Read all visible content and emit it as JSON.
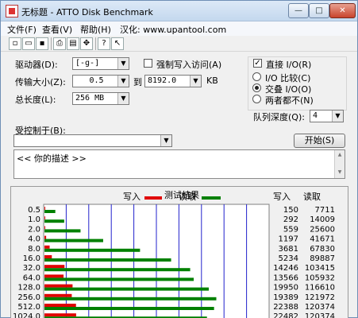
{
  "window": {
    "title": "无标题 - ATTO Disk Benchmark",
    "min": "—",
    "max": "□",
    "close": "✕"
  },
  "menu": [
    "文件(F)",
    "查看(V)",
    "帮助(H)",
    "汉化: www.upantool.com"
  ],
  "toolbar": [
    "new-icon",
    "open-icon",
    "save-icon",
    "print-icon",
    "preview-icon",
    "move-icon",
    "help-icon",
    "context-help-icon"
  ],
  "form": {
    "drive_label": "驱动器(D):",
    "drive_value": "[-g-]",
    "force_write_label": "强制写入访问(A)",
    "direct_io_label": "直接 I/O(R)",
    "transfer_label": "传输大小(Z):",
    "transfer_from": "0.5",
    "to_label": "到",
    "transfer_to": "8192.0",
    "kb_unit": "KB",
    "total_label": "总长度(L):",
    "total_value": "256 MB",
    "radio_compare": "I/O 比较(C)",
    "radio_overlap": "交叠 I/O(O)",
    "radio_neither": "两者都不(N)",
    "queue_label": "队列深度(Q):",
    "queue_value": "4",
    "controlled_label": "受控制于(B):",
    "controlled_value": "",
    "start_button": "开始(S)",
    "description": "<<  你的描述  >>"
  },
  "results": {
    "title": "测试结果",
    "write_legend": "写入",
    "read_legend": "读取",
    "write_col": "写入",
    "read_col": "读取",
    "write_color": "#e00000",
    "read_color": "#008000"
  },
  "chart_data": {
    "type": "bar",
    "title": "测试结果",
    "categories": [
      "0.5",
      "1.0",
      "2.0",
      "4.0",
      "8.0",
      "16.0",
      "32.0",
      "64.0",
      "128.0",
      "256.0",
      "512.0",
      "1024.0"
    ],
    "series": [
      {
        "name": "写入",
        "values": [
          150,
          292,
          559,
          1197,
          3681,
          5234,
          14246,
          13566,
          19950,
          19389,
          22388,
          22482
        ]
      },
      {
        "name": "读取",
        "values": [
          7711,
          14009,
          25600,
          41671,
          67830,
          89887,
          103415,
          105932,
          116610,
          121972,
          120374,
          115338
        ]
      }
    ],
    "write_labels": [
      "150",
      "292",
      "559",
      "1197",
      "3681",
      "5234",
      "14246",
      "13566",
      "19950",
      "19389",
      "22388",
      "22482"
    ],
    "read_labels": [
      "7711",
      "14009",
      "25600",
      "41671",
      "67830",
      "89887",
      "103415",
      "105932",
      "116610",
      "121972",
      "120374",
      "120374"
    ],
    "xlim": [
      0,
      160000
    ],
    "grid": true
  }
}
